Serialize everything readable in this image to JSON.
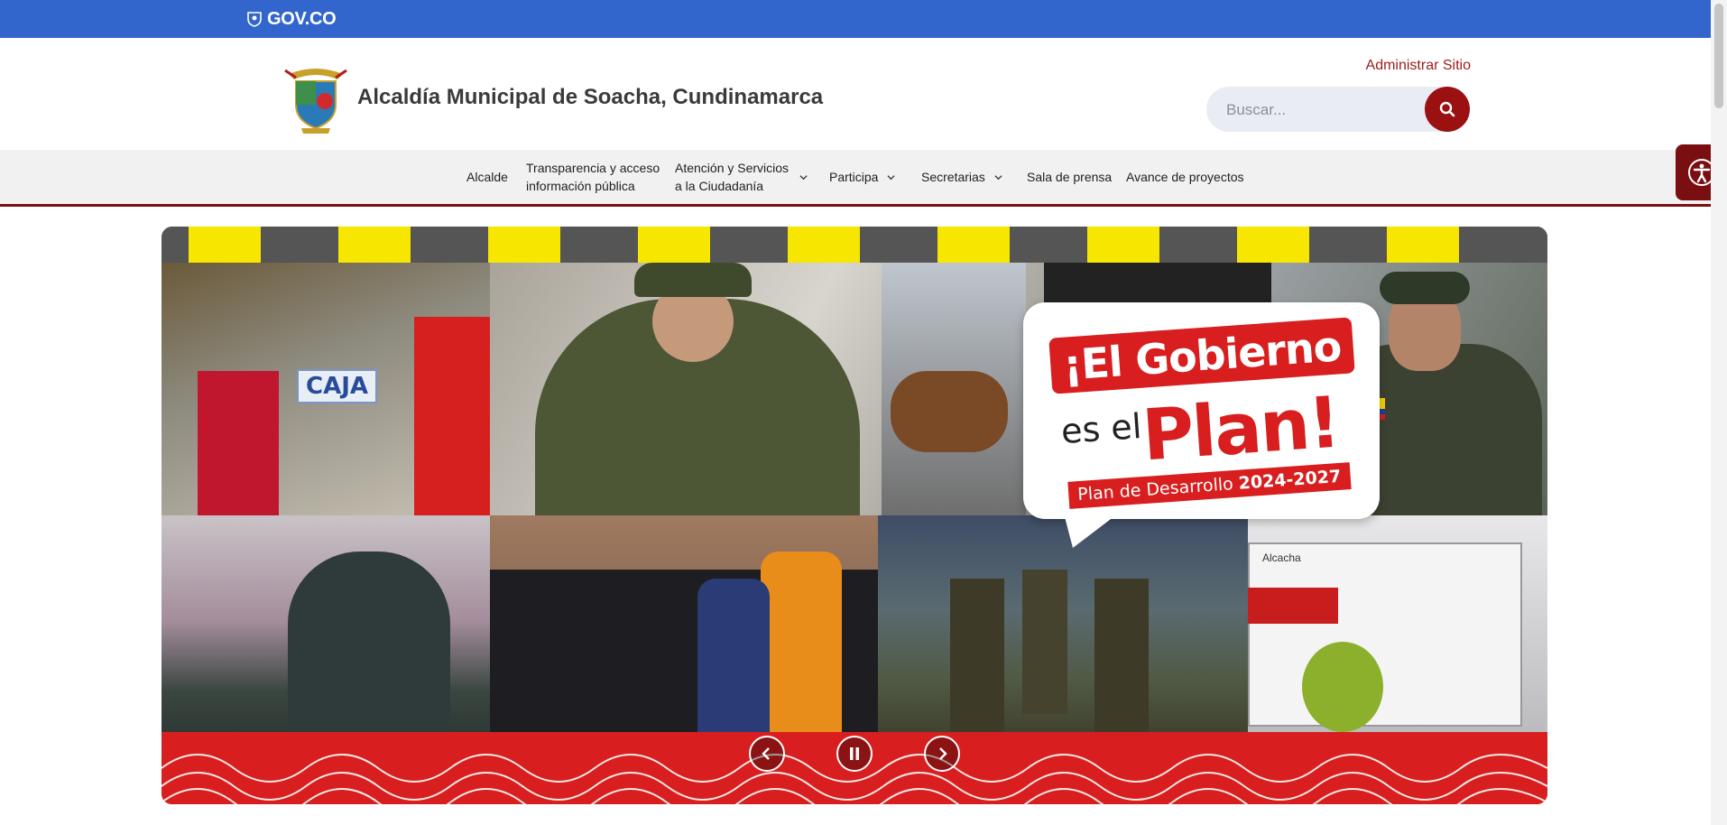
{
  "govbar": {
    "logo_text": "GOV.CO"
  },
  "header": {
    "site_title": "Alcaldía Municipal de Soacha, Cundinamarca",
    "admin_link": "Administrar Sitio",
    "search_placeholder": "Buscar..."
  },
  "nav": {
    "items": [
      {
        "label": "Alcalde"
      },
      {
        "label_line1": "Transparencia y acceso",
        "label_line2": "información pública"
      },
      {
        "label_line1": "Atención y Servicios",
        "label_line2": "a la Ciudadanía"
      },
      {
        "label": "Participa"
      },
      {
        "label": "Secretarias"
      },
      {
        "label": "Sala de prensa"
      },
      {
        "label": "Avance de proyectos"
      }
    ]
  },
  "banner": {
    "headline_1": "¡El Gobierno",
    "headline_2a": "es el",
    "headline_2b": "Plan!",
    "plan_prefix": "Plan de Desarrollo",
    "plan_years": "2024-2027",
    "caja_sign": "CAJA",
    "van_text": "Alcacha"
  },
  "colors": {
    "govbar": "#3366cc",
    "brand_red": "#9b1010",
    "nav_border": "#7a0f12"
  },
  "icons": {
    "search": "search-icon",
    "accessibility": "accessibility-icon",
    "prev": "chevron-left-icon",
    "pause": "pause-icon",
    "next": "chevron-right-icon"
  }
}
